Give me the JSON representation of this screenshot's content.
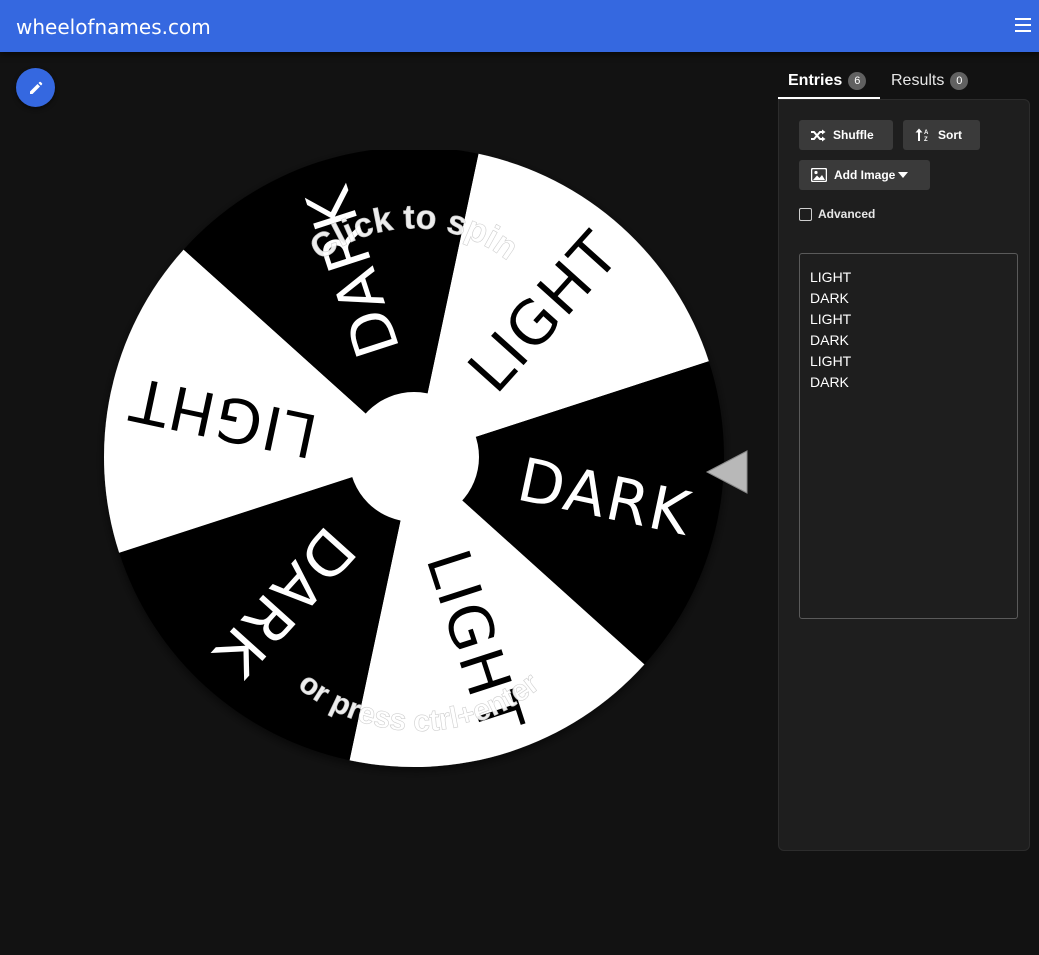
{
  "header": {
    "site_title": "wheelofnames.com",
    "menu_icon": "hamburger-menu-icon"
  },
  "toolbar": {
    "edit_icon": "pencil-icon"
  },
  "wheel": {
    "segments": [
      {
        "label": "LIGHT",
        "fill": "#ffffff",
        "text_color": "#000000"
      },
      {
        "label": "DARK",
        "fill": "#000000",
        "text_color": "#ffffff"
      },
      {
        "label": "LIGHT",
        "fill": "#ffffff",
        "text_color": "#000000"
      },
      {
        "label": "DARK",
        "fill": "#000000",
        "text_color": "#ffffff"
      },
      {
        "label": "LIGHT",
        "fill": "#ffffff",
        "text_color": "#000000"
      },
      {
        "label": "DARK",
        "fill": "#000000",
        "text_color": "#ffffff"
      }
    ],
    "hint_top": "Click to spin",
    "hint_bottom": "or press ctrl+enter",
    "pointer_icon": "pointer-arrow-icon"
  },
  "tabs": [
    {
      "label": "Entries",
      "count": "6"
    },
    {
      "label": "Results",
      "count": "0"
    }
  ],
  "actions": {
    "shuffle_label": "Shuffle",
    "sort_label": "Sort",
    "add_image_label": "Add Image",
    "advanced_label": "Advanced"
  },
  "entries": [
    "LIGHT",
    "DARK",
    "LIGHT",
    "DARK",
    "LIGHT",
    "DARK"
  ],
  "colors": {
    "accent": "#3568e0",
    "background": "#121212",
    "panel": "#1e1e1e"
  }
}
